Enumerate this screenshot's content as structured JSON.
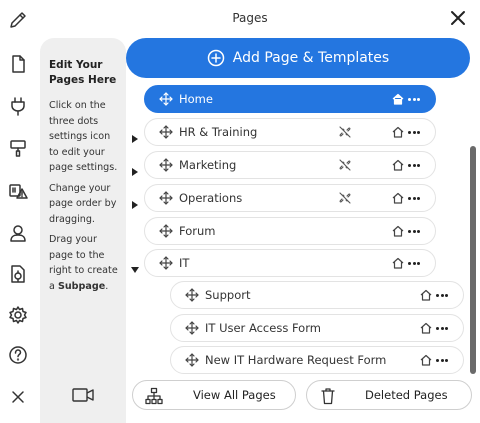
{
  "header": {
    "title": "Pages",
    "close_icon": "close-icon"
  },
  "rail": {
    "icons": [
      "pencil-icon",
      "page-icon",
      "plug-icon",
      "paint-roller-icon",
      "alert-icon",
      "user-icon",
      "file-settings-icon",
      "gear-icon",
      "help-icon",
      "close-icon"
    ]
  },
  "help": {
    "title": "Edit Your Pages Here",
    "p1": "Click on the three dots settings icon to edit your page settings.",
    "p2": "Change your page order by dragging.",
    "p3_prefix": "Drag your page to the right to create a ",
    "p3_bold": "Subpage",
    "p3_suffix": ".",
    "video_icon": "video-icon"
  },
  "add_button": {
    "label": "Add Page & Templates",
    "icon": "plus-circle-icon"
  },
  "pages": [
    {
      "label": "Home",
      "active": true,
      "caret": "",
      "unlinked": false,
      "level": 0,
      "home_filled": true
    },
    {
      "label": "HR & Training",
      "active": false,
      "caret": "collapsed",
      "unlinked": true,
      "level": 0
    },
    {
      "label": "Marketing",
      "active": false,
      "caret": "collapsed",
      "unlinked": true,
      "level": 0
    },
    {
      "label": "Operations",
      "active": false,
      "caret": "collapsed",
      "unlinked": true,
      "level": 0
    },
    {
      "label": "Forum",
      "active": false,
      "caret": "",
      "unlinked": false,
      "level": 0
    },
    {
      "label": "IT",
      "active": false,
      "caret": "expanded",
      "unlinked": false,
      "level": 0
    },
    {
      "label": "Support",
      "active": false,
      "caret": "",
      "unlinked": false,
      "level": 1
    },
    {
      "label": "IT User Access Form",
      "active": false,
      "caret": "",
      "unlinked": false,
      "level": 1
    },
    {
      "label": "New IT Hardware Request Form",
      "active": false,
      "caret": "",
      "unlinked": false,
      "level": 1
    }
  ],
  "bottom": {
    "view_all": {
      "label": "View All Pages",
      "icon": "sitemap-icon"
    },
    "deleted": {
      "label": "Deleted Pages",
      "icon": "trash-icon"
    }
  },
  "colors": {
    "accent": "#2476e0",
    "panel": "#efefef"
  }
}
